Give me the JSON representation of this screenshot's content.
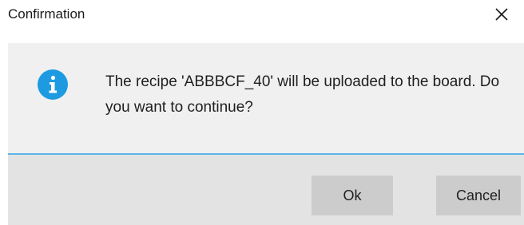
{
  "window": {
    "title": "Confirmation",
    "close_icon": "close-icon"
  },
  "message": {
    "icon": "info-icon",
    "icon_color": "#1e9be0",
    "text": "The recipe 'ABBBCF_40' will be uploaded to the board. Do you want to continue?"
  },
  "buttons": {
    "ok_label": "Ok",
    "cancel_label": "Cancel"
  },
  "colors": {
    "content_background": "#f0f0f0",
    "footer_background": "#e3e3e3",
    "button_background": "#cccccc",
    "separator": "#5bb7ea"
  }
}
